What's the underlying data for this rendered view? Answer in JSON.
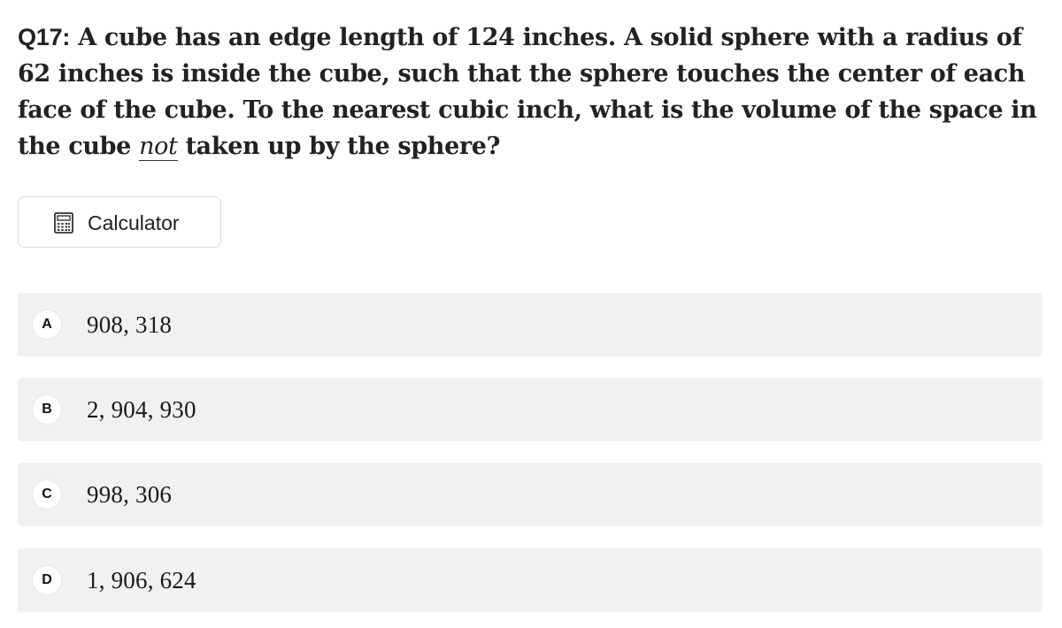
{
  "question": {
    "number": "Q17:",
    "text_before": " A cube has an edge length of 124 inches. A solid sphere with a radius of 62 inches is inside the cube, such that the sphere touches the center of each face of the cube. To the nearest cubic inch, what is the volume of the space in the cube ",
    "emphasis": "not",
    "text_after": " taken up by the sphere?"
  },
  "calculator": {
    "label": "Calculator",
    "icon": "calculator-icon"
  },
  "choices": [
    {
      "letter": "A",
      "value": "908, 318"
    },
    {
      "letter": "B",
      "value": "2, 904, 930"
    },
    {
      "letter": "C",
      "value": "998, 306"
    },
    {
      "letter": "D",
      "value": "1, 906, 624"
    }
  ],
  "colors": {
    "choice_bg": "#f1f1f1",
    "text": "#1f1f1f",
    "border": "#d9d9d9"
  }
}
